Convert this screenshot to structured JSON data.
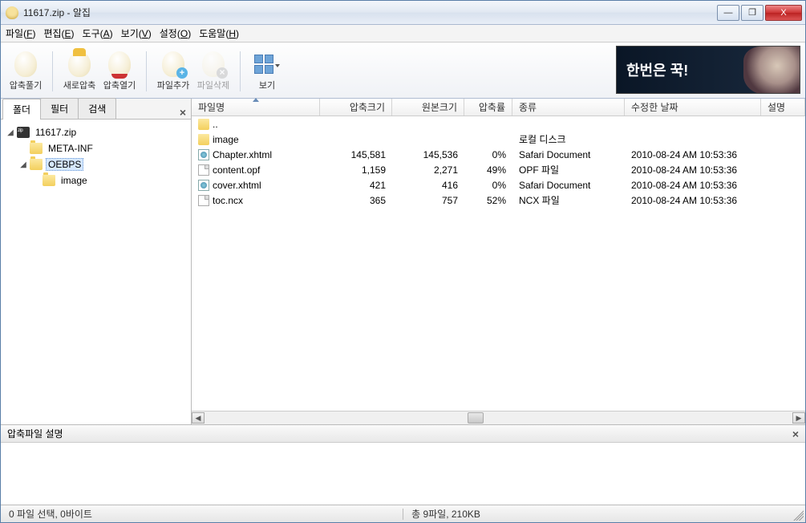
{
  "window": {
    "title": "11617.zip - 알집"
  },
  "win_controls": {
    "min": "—",
    "max": "❐",
    "close": "X"
  },
  "menubar": [
    {
      "label": "파일",
      "key": "F"
    },
    {
      "label": "편집",
      "key": "E"
    },
    {
      "label": "도구",
      "key": "A"
    },
    {
      "label": "보기",
      "key": "V"
    },
    {
      "label": "설정",
      "key": "O"
    },
    {
      "label": "도움말",
      "key": "H"
    }
  ],
  "toolbar": {
    "extract": "압축풀기",
    "new": "새로압축",
    "open": "압축열기",
    "add": "파일추가",
    "delete": "파일삭제",
    "view": "보기"
  },
  "ad": {
    "text": "한번은 꾹!"
  },
  "sidebar": {
    "tabs": {
      "folder": "폴더",
      "filter": "필터",
      "search": "검색"
    },
    "tree": {
      "root": "11617.zip",
      "metainf": "META-INF",
      "oebps": "OEBPS",
      "image": "image"
    }
  },
  "columns": {
    "name": "파일명",
    "csize": "압축크기",
    "osize": "원본크기",
    "ratio": "압축률",
    "type": "종류",
    "date": "수정한 날짜",
    "desc": "설명"
  },
  "files": [
    {
      "name": "..",
      "icon": "folder",
      "csize": "",
      "osize": "",
      "ratio": "",
      "type": "",
      "date": ""
    },
    {
      "name": "image",
      "icon": "folder",
      "csize": "",
      "osize": "",
      "ratio": "",
      "type": "로컬 디스크",
      "date": ""
    },
    {
      "name": "Chapter.xhtml",
      "icon": "web",
      "csize": "145,581",
      "osize": "145,536",
      "ratio": "0%",
      "type": "Safari Document",
      "date": "2010-08-24 AM 10:53:36"
    },
    {
      "name": "content.opf",
      "icon": "doc",
      "csize": "1,159",
      "osize": "2,271",
      "ratio": "49%",
      "type": "OPF 파일",
      "date": "2010-08-24 AM 10:53:36"
    },
    {
      "name": "cover.xhtml",
      "icon": "web",
      "csize": "421",
      "osize": "416",
      "ratio": "0%",
      "type": "Safari Document",
      "date": "2010-08-24 AM 10:53:36"
    },
    {
      "name": "toc.ncx",
      "icon": "doc",
      "csize": "365",
      "osize": "757",
      "ratio": "52%",
      "type": "NCX 파일",
      "date": "2010-08-24 AM 10:53:36"
    }
  ],
  "desc_panel": {
    "title": "압축파일 설명"
  },
  "status": {
    "selection": "0 파일 선택, 0바이트",
    "total": "총 9파일, 210KB"
  }
}
